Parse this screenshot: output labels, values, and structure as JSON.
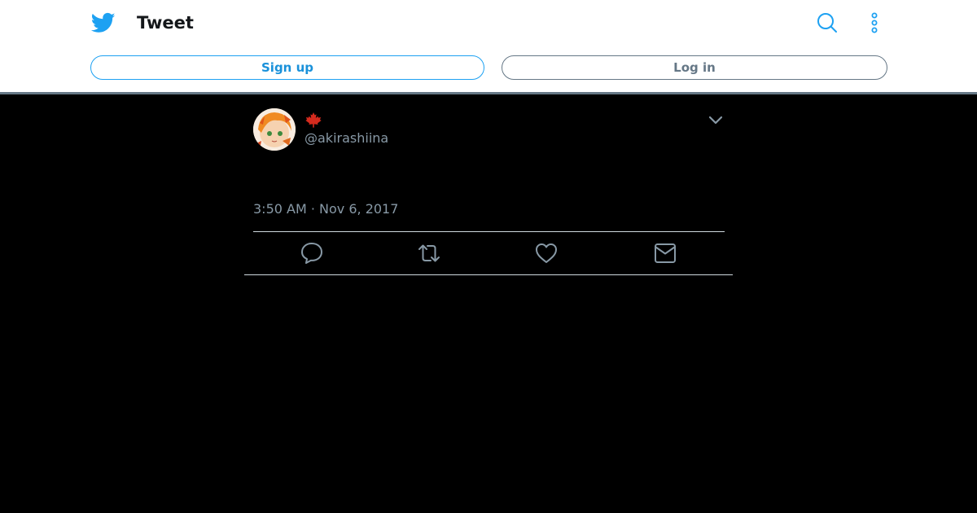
{
  "header": {
    "title": "Tweet",
    "bird_icon": "twitter-bird-icon",
    "search_icon": "search-icon",
    "more_icon": "more-vertical-icon"
  },
  "buttons": {
    "signup_label": "Sign up",
    "login_label": "Log in"
  },
  "tweet": {
    "display_name_icon": "maple-leaf-icon",
    "handle": "@akirashiina",
    "timestamp": "3:50 AM · Nov 6, 2017",
    "menu_icon": "chevron-down-icon",
    "actions": {
      "reply_icon": "reply-icon",
      "retweet_icon": "retweet-icon",
      "like_icon": "heart-icon",
      "dm_icon": "envelope-icon"
    }
  },
  "colors": {
    "accent": "#1da1f2",
    "muted": "#8899a6",
    "background": "#000000",
    "header_bg": "#ffffff"
  }
}
